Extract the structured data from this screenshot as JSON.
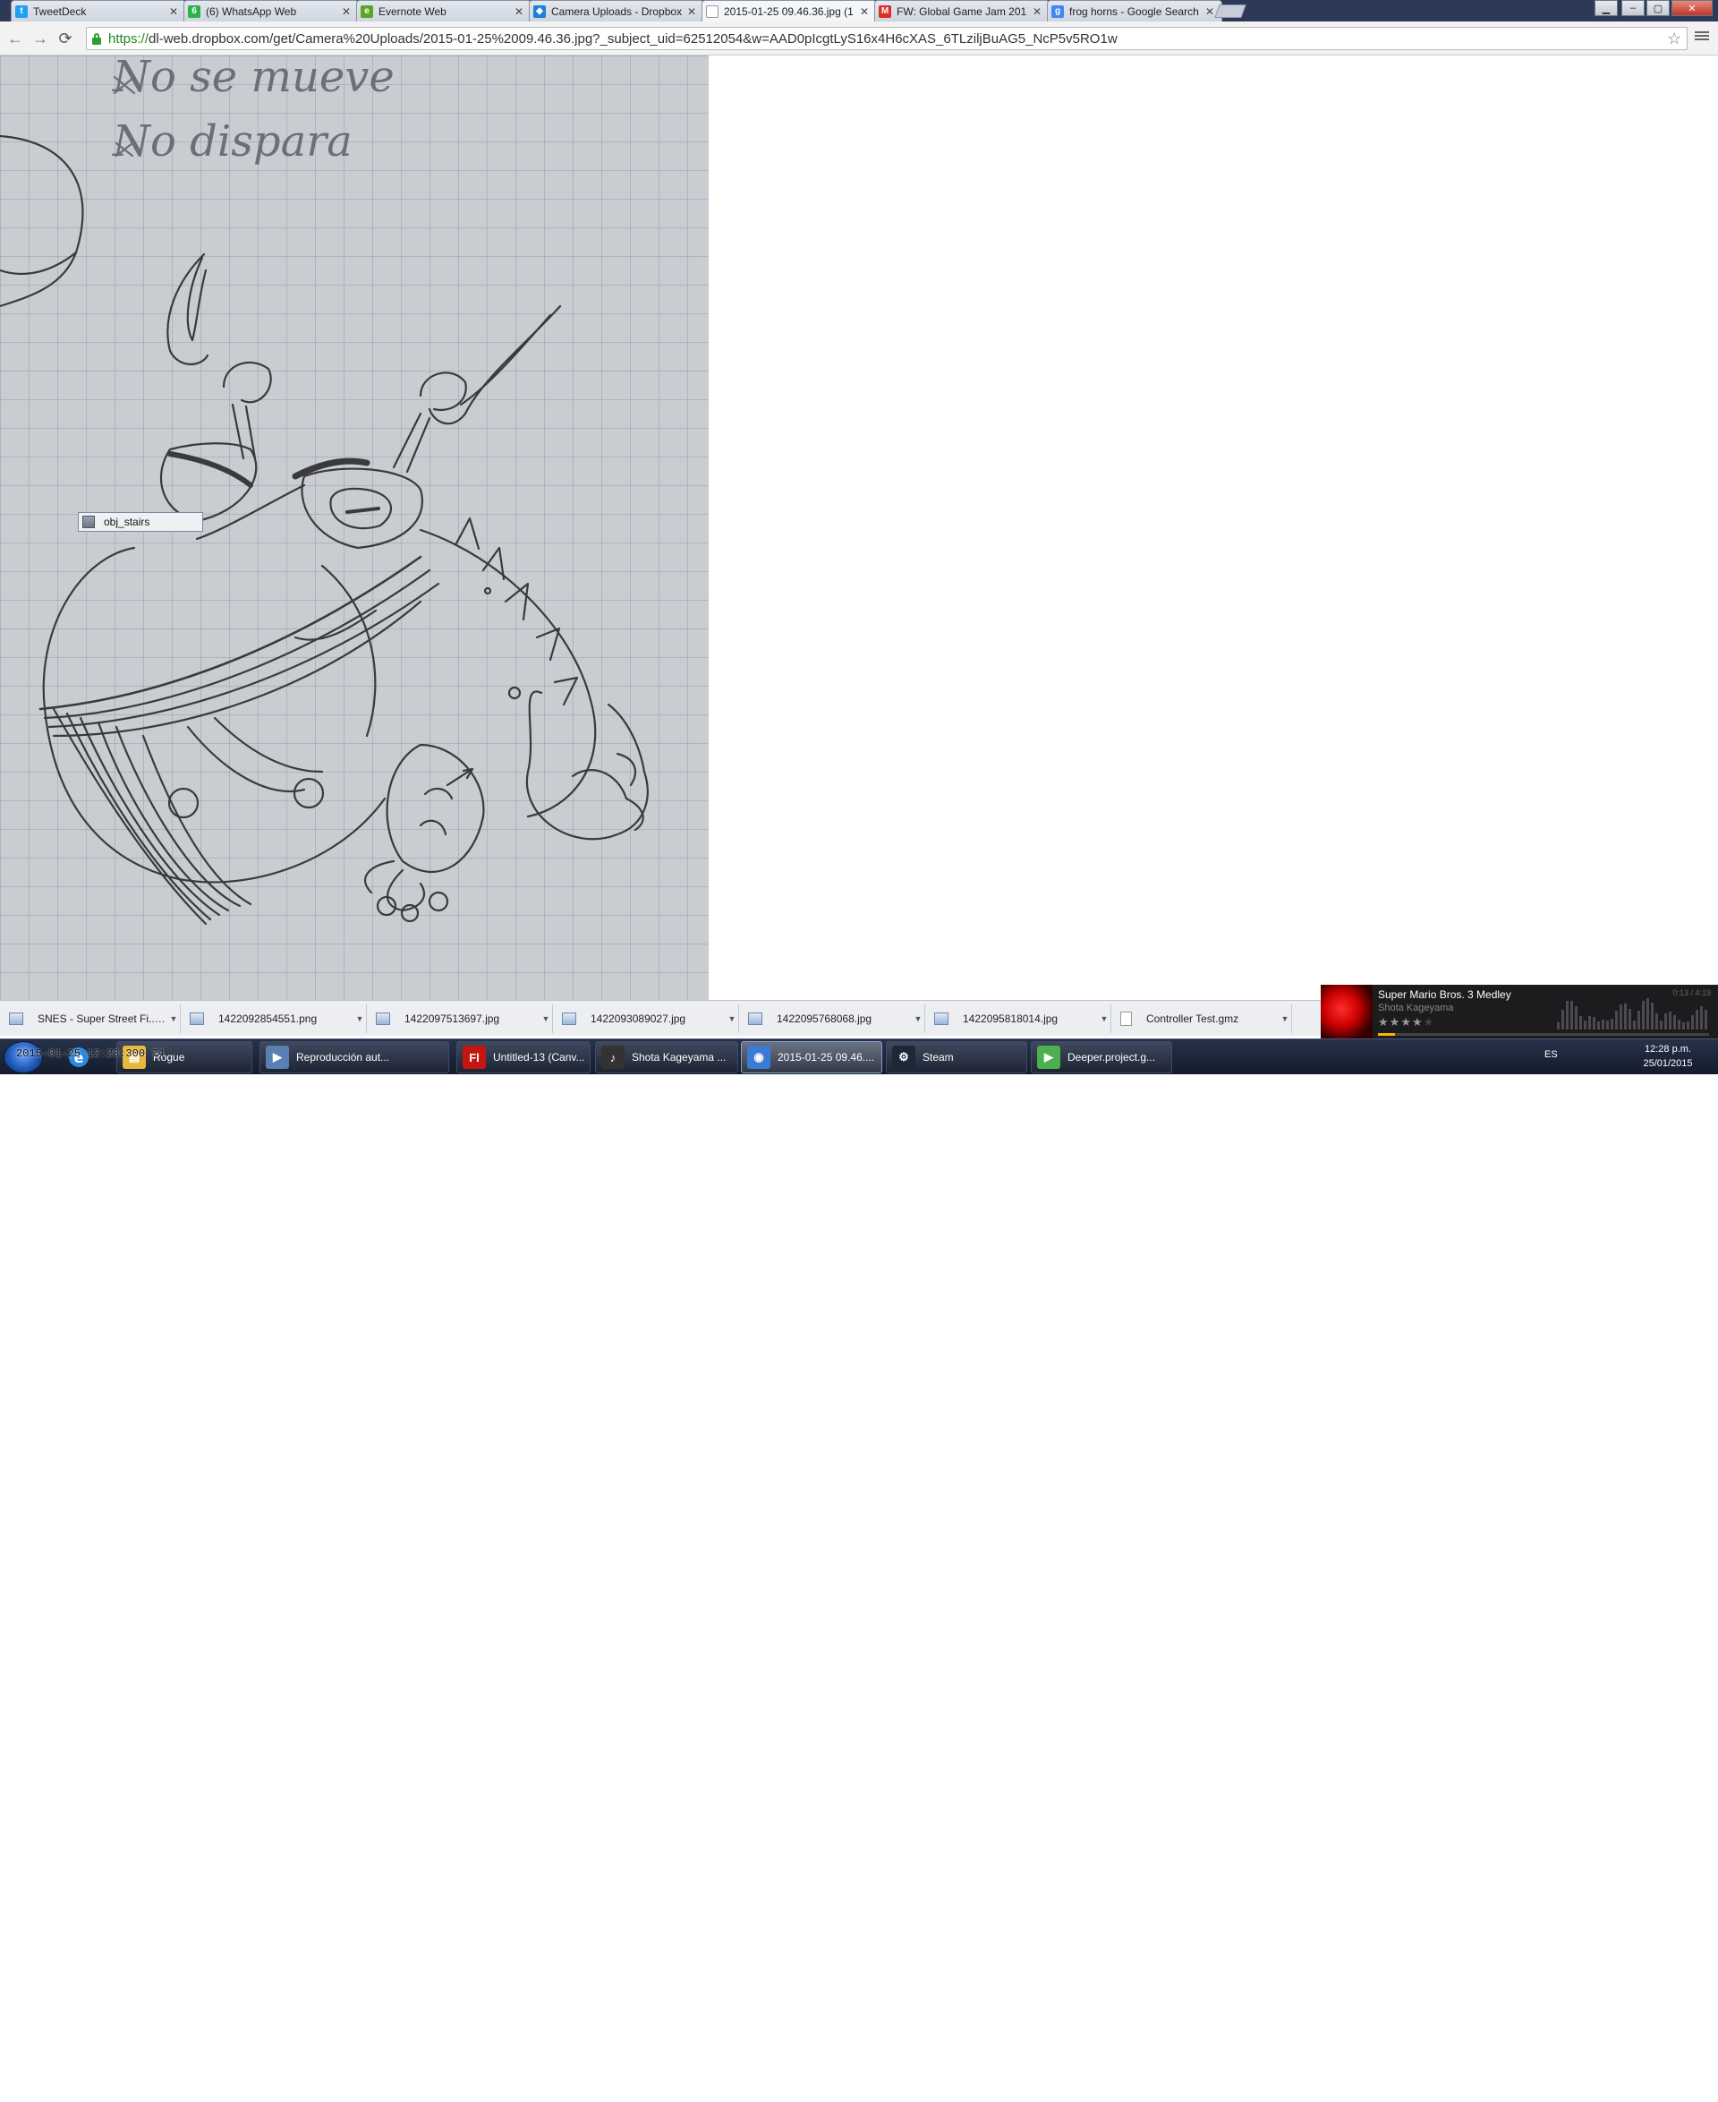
{
  "browser": {
    "tabs": [
      {
        "title": "TweetDeck",
        "icon": "twitter-icon",
        "color": "#1da1f2",
        "glyph": "t",
        "active": false
      },
      {
        "title": "(6) WhatsApp Web",
        "icon": "whatsapp-icon",
        "color": "#2bb34a",
        "glyph": "6",
        "active": false
      },
      {
        "title": "Evernote Web",
        "icon": "evernote-icon",
        "color": "#5ba525",
        "glyph": "e",
        "active": false
      },
      {
        "title": "Camera Uploads - Dropbox",
        "icon": "dropbox-icon",
        "color": "#1f7fd6",
        "glyph": "◆",
        "active": false
      },
      {
        "title": "2015-01-25 09.46.36.jpg (1",
        "icon": "page-icon",
        "color": "#ffffff",
        "glyph": "",
        "active": true
      },
      {
        "title": "FW: Global Game Jam 201",
        "icon": "gmail-icon",
        "color": "#d93025",
        "glyph": "M",
        "active": false
      },
      {
        "title": "frog horns - Google Search",
        "icon": "google-icon",
        "color": "#4285f4",
        "glyph": "g",
        "active": false
      }
    ],
    "url_scheme": "https://",
    "url_rest": "dl-web.dropbox.com/get/Camera%20Uploads/2015-01-25%2009.46.36.jpg?_subject_uid=62512054&w=AAD0pIcgtLyS16x4H6cXAS_6TLziljBuAG5_NcP5v5RO1w"
  },
  "viewer": {
    "drag_label": "obj_stairs",
    "sketch_note_line1": "No se mueve",
    "sketch_note_line2": "No dispara"
  },
  "downloads": [
    {
      "name": "SNES - Super Street Fi....gif",
      "type": "image"
    },
    {
      "name": "1422092854551.png",
      "type": "image"
    },
    {
      "name": "1422097513697.jpg",
      "type": "image"
    },
    {
      "name": "1422093089027.jpg",
      "type": "image"
    },
    {
      "name": "1422095768068.jpg",
      "type": "image"
    },
    {
      "name": "1422095818014.jpg",
      "type": "image"
    },
    {
      "name": "Controller Test.gmz",
      "type": "doc"
    }
  ],
  "music": {
    "title": "Super Mario Bros. 3 Medley",
    "artist": "Shota Kageyama",
    "time": "0:13 / 4:19",
    "rating_stars": 4,
    "progress": 0.05
  },
  "taskbar": {
    "overlay_time": "2015-01-25 12:28:300 74",
    "items": [
      {
        "label": "Rogue",
        "icon": "folder-icon",
        "color": "#e8b93a",
        "glyph": "▤"
      },
      {
        "label": "Reproducción aut...",
        "icon": "autoplay-icon",
        "color": "#5a7fb3",
        "glyph": "▶"
      },
      {
        "label": "Untitled-13 (Canv...",
        "icon": "flash-icon",
        "color": "#c4160f",
        "glyph": "Fl"
      },
      {
        "label": "Shota Kageyama ...",
        "icon": "music-player-icon",
        "color": "#333333",
        "glyph": "♪"
      },
      {
        "label": "2015-01-25 09.46....",
        "icon": "chrome-icon",
        "color": "#3a7bd5",
        "glyph": "◉"
      },
      {
        "label": "Steam",
        "icon": "steam-icon",
        "color": "#1b2838",
        "glyph": "⚙"
      },
      {
        "label": "Deeper.project.g...",
        "icon": "gamemaker-icon",
        "color": "#4caf50",
        "glyph": "▶"
      }
    ],
    "lang": "ES",
    "clock_time": "12:28 p.m.",
    "clock_date": "25/01/2015"
  }
}
